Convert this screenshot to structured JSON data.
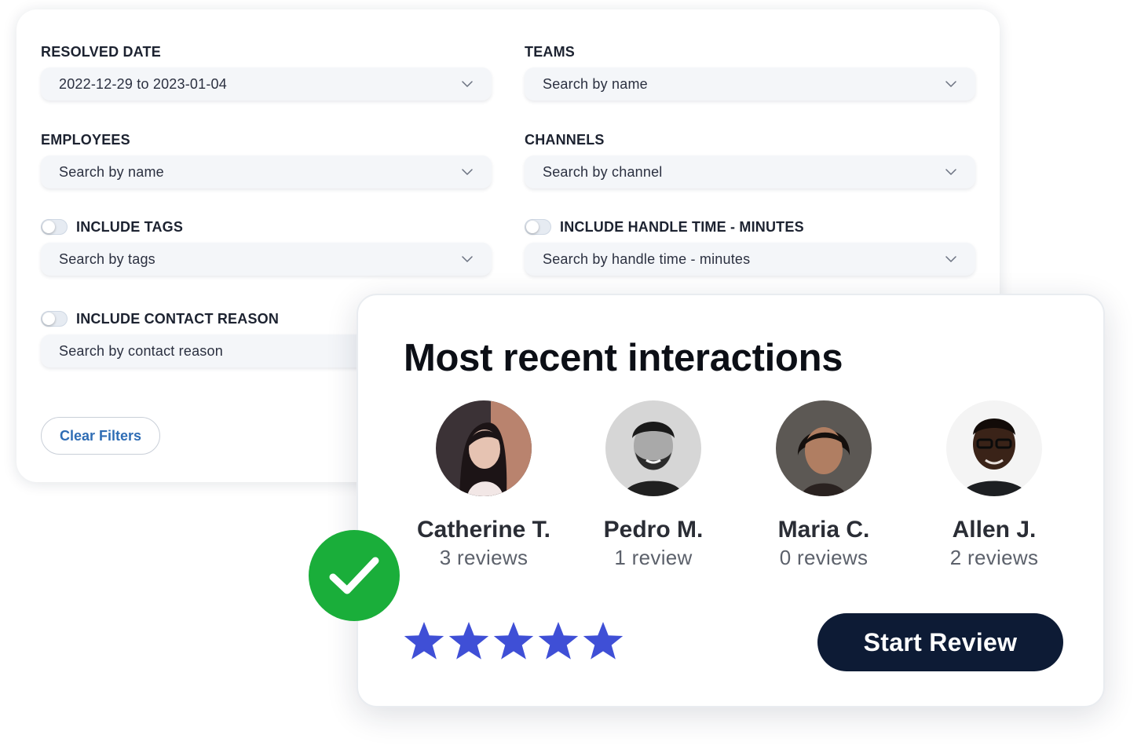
{
  "filters": {
    "resolved_date": {
      "label": "RESOLVED DATE",
      "value": "2022-12-29 to 2023-01-04"
    },
    "teams": {
      "label": "TEAMS",
      "placeholder": "Search by name"
    },
    "employees": {
      "label": "EMPLOYEES",
      "placeholder": "Search by name"
    },
    "channels": {
      "label": "CHANNELS",
      "placeholder": "Search by channel"
    },
    "tags": {
      "label": "INCLUDE TAGS",
      "placeholder": "Search by tags",
      "enabled": false
    },
    "handle_time": {
      "label": "INCLUDE HANDLE TIME - MINUTES",
      "placeholder": "Search by handle time - minutes",
      "enabled": false
    },
    "contact_reason": {
      "label": "INCLUDE CONTACT REASON",
      "placeholder": "Search by contact reason",
      "enabled": false
    },
    "clear_label": "Clear Filters"
  },
  "interactions": {
    "title": "Most recent interactions",
    "people": [
      {
        "name": "Catherine T.",
        "reviews": "3 reviews"
      },
      {
        "name": "Pedro M.",
        "reviews": "1 review"
      },
      {
        "name": "Maria C.",
        "reviews": "0 reviews"
      },
      {
        "name": "Allen J.",
        "reviews": "2 reviews"
      }
    ],
    "rating": 5,
    "rating_max": 5,
    "star_color": "#3f4fd6",
    "start_label": "Start Review",
    "start_color": "#0d1b35"
  },
  "badge": {
    "icon": "checkmark-icon",
    "color": "#1aae3a"
  }
}
